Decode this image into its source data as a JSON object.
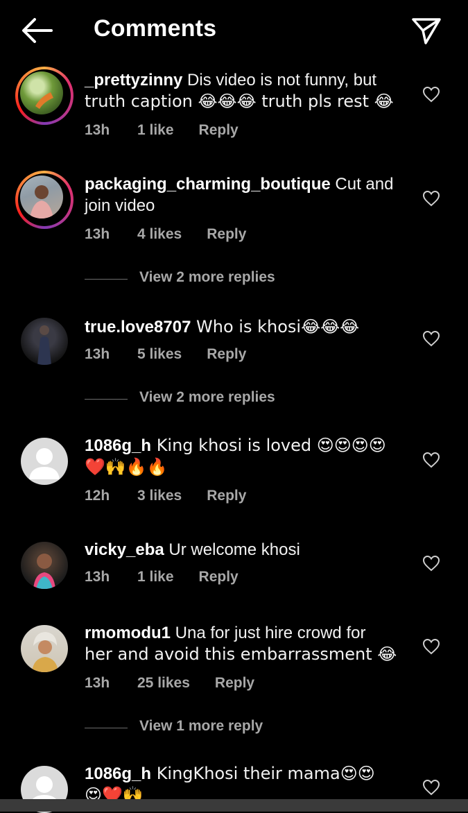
{
  "header": {
    "title": "Comments",
    "back_icon": "arrow-left-icon",
    "share_icon": "paper-plane-icon"
  },
  "comments": [
    {
      "username": "_prettyzinny",
      "text_line1": " Dis video is not funny, but",
      "text_line2": "truth caption 😂😂😂 truth pls rest 😂",
      "time": "13h",
      "likes": "1 like",
      "reply": "Reply"
    },
    {
      "username": "packaging_charming_boutique",
      "text_line1": " Cut and",
      "text_line2": "join video",
      "time": "13h",
      "likes": "4 likes",
      "reply": "Reply"
    },
    {
      "username": "true.love8707",
      "text_line1": " Who is khosi😂😂😂",
      "time": "13h",
      "likes": "5 likes",
      "reply": "Reply"
    },
    {
      "username": "1086g_h",
      "text_line1": " King khosi is loved 😍😍😍😍",
      "text_line2": "❤️🙌🔥🔥",
      "time": "12h",
      "likes": "3 likes",
      "reply": "Reply"
    },
    {
      "username": "vicky_eba",
      "text_line1": " Ur welcome khosi",
      "time": "13h",
      "likes": "1 like",
      "reply": "Reply"
    },
    {
      "username": "rmomodu1",
      "text_line1": " Una for just hire crowd for",
      "text_line2": "her and avoid this embarrassment 😂",
      "time": "13h",
      "likes": "25 likes",
      "reply": "Reply"
    },
    {
      "username": "1086g_h",
      "text_line1": " KingKhosi their mama😍😍",
      "text_line2": "😍❤️🙌"
    }
  ],
  "more_replies": [
    "View 2 more replies",
    "View 2 more replies",
    "View 1 more reply"
  ],
  "colors": {
    "background": "#000000",
    "text": "#f5f5f5",
    "muted": "#a8a8a8"
  }
}
